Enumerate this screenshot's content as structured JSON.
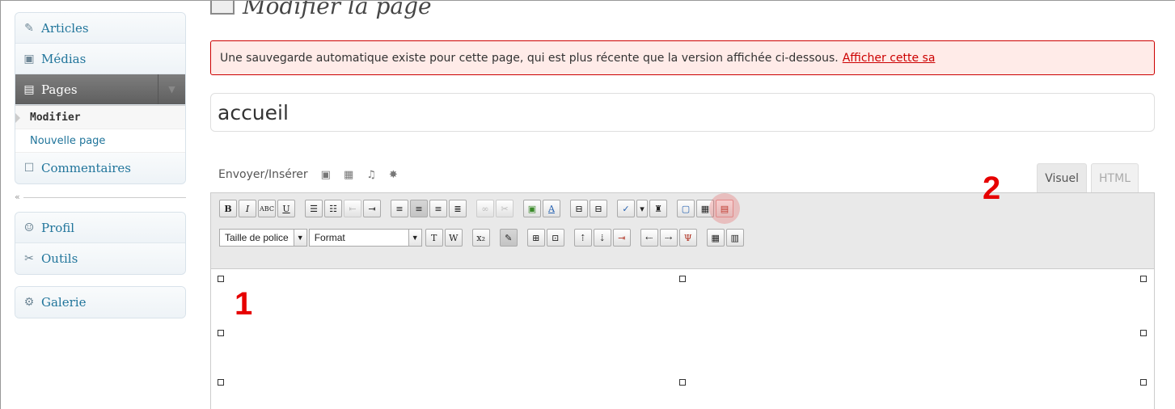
{
  "sidebar": {
    "items_top": [
      {
        "label": "Articles",
        "icon": "pin-icon"
      },
      {
        "label": "Médias",
        "icon": "media-icon"
      }
    ],
    "pages": {
      "label": "Pages",
      "icon": "pages-icon"
    },
    "submenu": [
      {
        "label": "Modifier",
        "active": true
      },
      {
        "label": "Nouvelle page",
        "active": false
      }
    ],
    "comments": {
      "label": "Commentaires",
      "icon": "comments-icon"
    },
    "collapse": "«",
    "items_bottom": [
      {
        "label": "Profil",
        "icon": "users-icon"
      },
      {
        "label": "Outils",
        "icon": "tools-icon"
      }
    ],
    "gallery": {
      "label": "Galerie",
      "icon": "gear-icon"
    }
  },
  "main": {
    "title": "Modifier la page",
    "notice_text": "Une sauvegarde automatique existe pour cette page, qui est plus récente que la version affichée ci-dessous.",
    "notice_link": "Afficher cette sa",
    "page_title_value": "accueil",
    "media_label": "Envoyer/Insérer",
    "tab_visual": "Visuel",
    "tab_html": "HTML",
    "font_size_label": "Taille de police",
    "format_label": "Format"
  },
  "annotations": {
    "marker1": "1",
    "marker2": "2"
  },
  "colors": {
    "link": "#21759b",
    "notice_border": "#cc0000",
    "marker": "#e60000"
  }
}
